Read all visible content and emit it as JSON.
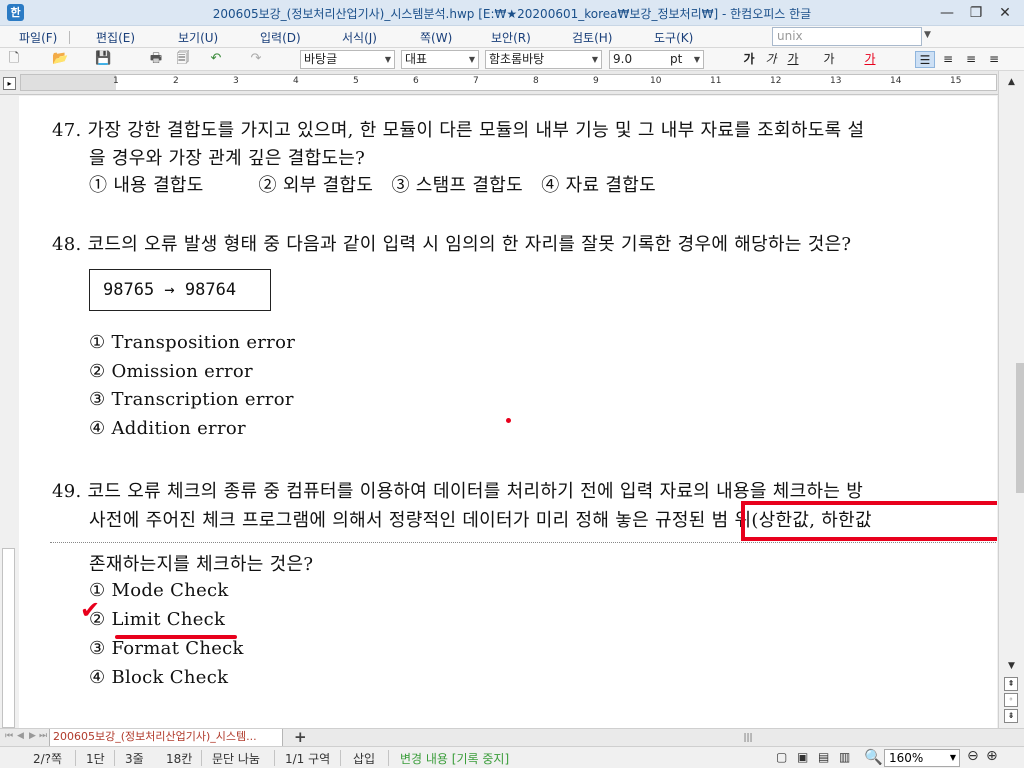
{
  "titlebar": {
    "title": "200605보강_(정보처리산업기사)_시스템분석.hwp [E:₩★20200601_korea₩보강_정보처리₩] - 한컴오피스 한글",
    "minimize": "—",
    "restore": "❐",
    "close": "✕"
  },
  "menu": {
    "items": [
      "파일(F)",
      "편집(E)",
      "보기(U)",
      "입력(D)",
      "서식(J)",
      "쪽(W)",
      "보안(R)",
      "검토(H)",
      "도구(K)"
    ],
    "search_value": "unix"
  },
  "toolbar": {
    "style_value": "바탕글",
    "lang_value": "대표",
    "font_value": "함초롬바탕",
    "size_value": "9.0",
    "size_unit": "pt",
    "bold": "가",
    "italic": "가",
    "underline": "가",
    "strike": "가",
    "color": "가"
  },
  "ruler": {
    "numbers": [
      "1",
      "2",
      "3",
      "4",
      "5",
      "6",
      "7",
      "8",
      "9",
      "10",
      "11",
      "12",
      "13",
      "14",
      "15"
    ]
  },
  "document": {
    "q47_line1": "47. 가장 강한 결합도를 가지고 있으며, 한 모듈이 다른 모듈의 내부 기능 및 그 내부 자료를 조회하도록 설",
    "q47_line2": "을 경우와 가장 관계 깊은 결합도는?",
    "q47_options": "① 내용 결합도　　　② 외부 결합도　③ 스탬프 결합도　④ 자료 결합도",
    "q48_line1": "48. 코드의 오류 발생 형태 중 다음과 같이 입력 시 임의의 한 자리를 잘못 기록한 경우에 해당하는 것은?",
    "q48_box": "98765 → 98764",
    "q48_options": [
      "① Transposition error",
      "② Omission error",
      "③ Transcription error",
      "④ Addition error"
    ],
    "q49_line1": "49. 코드 오류 체크의 종류 중 컴퓨터를 이용하여 데이터를 처리하기 전에 입력 자료의 내용을 체크하는 방",
    "q49_line2": "사전에 주어진 체크 프로그램에 의해서 정량적인 데이터가 미리 정해 놓은 규정된 범 위(상한값, 하한값",
    "q49_line3": "존재하는지를 체크하는 것은?",
    "q49_options": [
      "① Mode Check",
      "② Limit Check",
      "③ Format Check",
      "④ Block Check"
    ],
    "check_mark": "✔"
  },
  "tabs": {
    "doc_tab": "200605보강_(정보처리산업기사)_시스템...",
    "add": "+"
  },
  "status": {
    "page": "2/?쪽",
    "section": "1단",
    "line": "3줄",
    "col": "18칸",
    "para": "문단 나눔",
    "area": "1/1 구역",
    "mode": "삽입",
    "track": "변경 내용 [기록 중지]",
    "zoom": "160%"
  },
  "colors": {
    "annotation": "#e8001c",
    "menu_text": "#1a3f7a",
    "track_text": "#3a9d3a"
  }
}
